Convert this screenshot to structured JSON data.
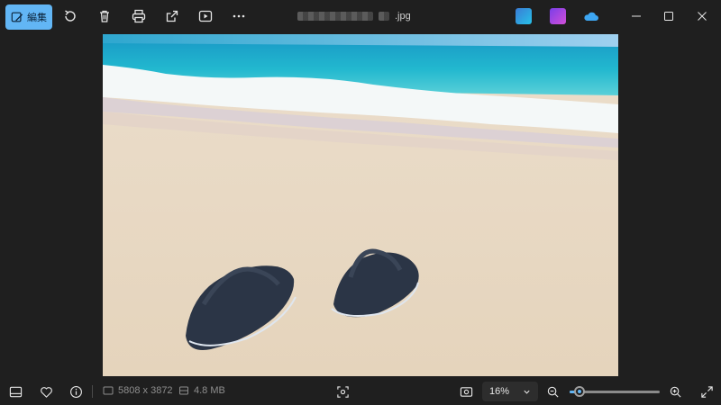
{
  "toolbar": {
    "edit_label": "編集",
    "buttons": [
      "rotate-icon",
      "delete-icon",
      "print-icon",
      "share-icon",
      "slideshow-icon",
      "more-icon"
    ]
  },
  "title": {
    "filename_suffix": ".jpg"
  },
  "right_apps": [
    "clipchamp-icon",
    "designer-icon",
    "onedrive-icon"
  ],
  "window": [
    "minimize-icon",
    "maximize-icon",
    "close-icon"
  ],
  "photo": {
    "description_colors": {
      "sky": "#7fc6f0",
      "sea": "#1eb5c9",
      "sand": "#e9dccb"
    }
  },
  "status": {
    "dimensions": "5808 x 3872",
    "filesize": "4.8 MB",
    "zoom": "16%",
    "zoom_fraction": 0.06
  },
  "colors": {
    "accent": "#62b6f5",
    "bg": "#1f1f1f"
  }
}
